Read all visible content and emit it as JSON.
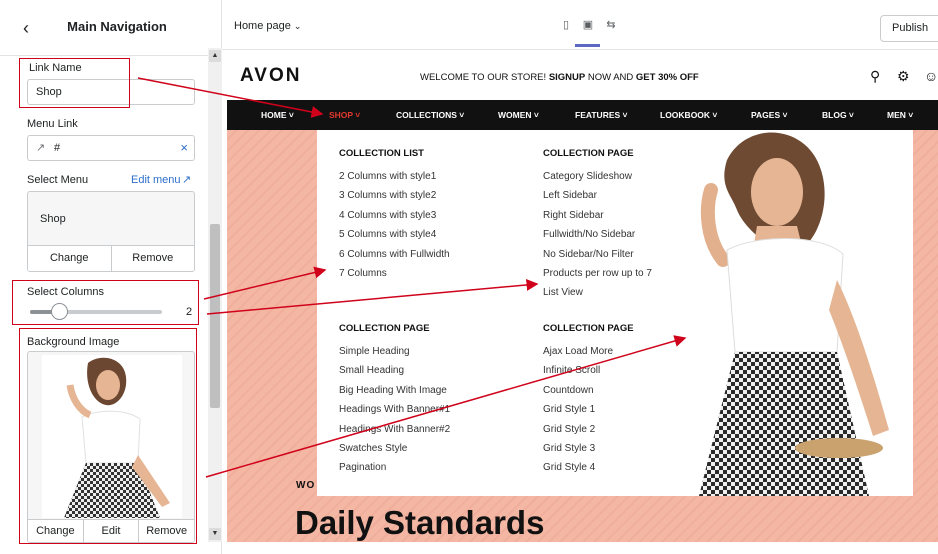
{
  "panel": {
    "title": "Main Navigation",
    "link_name_label": "Link Name",
    "link_name_value": "Shop",
    "menu_link_label": "Menu Link",
    "menu_link_value": "#",
    "select_menu_label": "Select Menu",
    "edit_menu_label": "Edit menu",
    "selected_menu": "Shop",
    "change_label": "Change",
    "remove_label": "Remove",
    "select_columns_label": "Select Columns",
    "select_columns_value": "2",
    "select_columns_fraction": 0.2,
    "bg_image_label": "Background Image",
    "bg_change_label": "Change",
    "bg_edit_label": "Edit",
    "bg_remove_label": "Remove"
  },
  "topbar": {
    "page_select": "Home page",
    "publish_label": "Publish"
  },
  "store": {
    "logo": "AVON",
    "welcome_prefix": "WELCOME TO OUR STORE!",
    "welcome_signup": "SIGNUP",
    "welcome_mid": "NOW AND",
    "welcome_offer": "GET 30% OFF",
    "nav": [
      "HOME",
      "SHOP",
      "COLLECTIONS",
      "WOMEN",
      "FEATURES",
      "LOOKBOOK",
      "PAGES",
      "BLOG",
      "MEN"
    ],
    "active_nav": "SHOP",
    "hero_small": "WO",
    "hero_headline": "Daily Standards"
  },
  "mega_menu": {
    "columns": [
      {
        "title": "COLLECTION LIST",
        "links": [
          "2 Columns with style1",
          "3 Columns with style2",
          "4 Columns with style3",
          "5 Columns with style4",
          "6 Columns with Fullwidth",
          "7 Columns"
        ]
      },
      {
        "title": "COLLECTION PAGE",
        "links": [
          "Category Slideshow",
          "Left Sidebar",
          "Right Sidebar",
          "Fullwidth/No Sidebar",
          "No Sidebar/No Filter",
          "Products per row up to 7",
          "List View"
        ]
      },
      {
        "title": "COLLECTION PAGE",
        "links": [
          "Simple Heading",
          "Small Heading",
          "Big Heading With Image",
          "Headings With Banner#1",
          "Headings With Banner#2",
          "Swatches Style",
          "Pagination"
        ]
      },
      {
        "title": "COLLECTION PAGE",
        "links": [
          "Ajax Load More",
          "Infinite Scroll",
          "Countdown",
          "Grid Style 1",
          "Grid Style 2",
          "Grid Style 3",
          "Grid Style 4"
        ]
      }
    ]
  },
  "colors": {
    "accent": "#d0021b",
    "link_blue": "#2c6ecb",
    "nav_bg": "#111111",
    "active_nav": "#e03a2e",
    "hero_bg": "#f4b8a6"
  }
}
